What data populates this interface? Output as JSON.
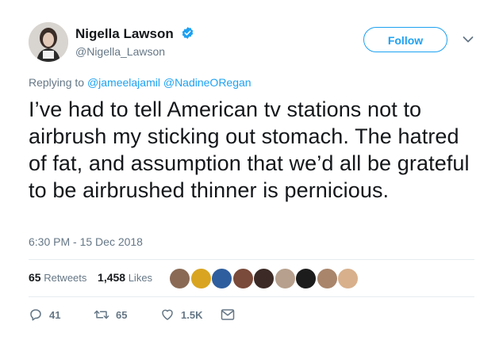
{
  "author": {
    "display_name": "Nigella Lawson",
    "handle": "@Nigella_Lawson",
    "verified": true
  },
  "follow_button": {
    "label": "Follow"
  },
  "reply_context": {
    "prefix": "Replying to",
    "mentions": [
      "@jameelajamil",
      "@NadineORegan"
    ]
  },
  "tweet": {
    "text": "I’ve had to tell American tv stations not to airbrush my sticking out stomach. The hatred of fat, and assumption that we’d all be grateful to be airbrushed thinner is pernicious.",
    "timestamp": "6:30 PM - 15 Dec 2018"
  },
  "stats": {
    "retweets_count": "65",
    "retweets_label": "Retweets",
    "likes_count": "1,458",
    "likes_label": "Likes"
  },
  "likers": [
    {
      "color": "#8a6a55"
    },
    {
      "color": "#d9a520"
    },
    {
      "color": "#2f5e9e"
    },
    {
      "color": "#7a4a3a"
    },
    {
      "color": "#3b2a26"
    },
    {
      "color": "#b7a08d"
    },
    {
      "color": "#1c1c1c"
    },
    {
      "color": "#a9856b"
    },
    {
      "color": "#d8b08c"
    }
  ],
  "actions": {
    "reply_count": "41",
    "retweet_count": "65",
    "like_count": "1.5K"
  },
  "colors": {
    "accent": "#1da1f2",
    "text_primary": "#14171a",
    "text_secondary": "#657786",
    "divider": "#e6ecf0"
  }
}
